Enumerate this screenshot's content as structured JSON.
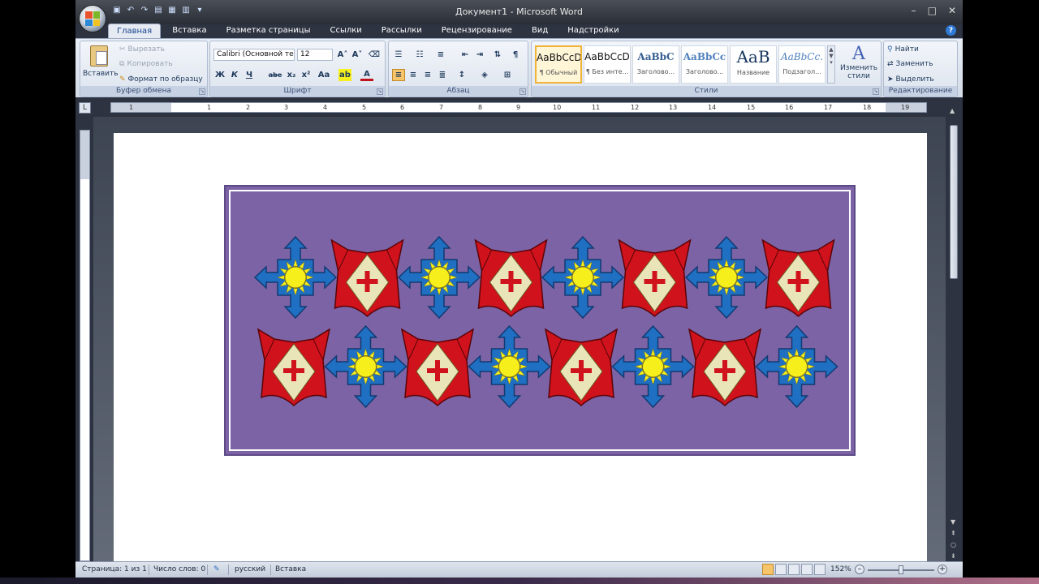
{
  "window": {
    "title": "Документ1 - Microsoft Word"
  },
  "window_controls": {
    "minimize": "–",
    "maximize": "□",
    "close": "✕"
  },
  "tabs": [
    {
      "label": "Главная"
    },
    {
      "label": "Вставка"
    },
    {
      "label": "Разметка страницы"
    },
    {
      "label": "Ссылки"
    },
    {
      "label": "Рассылки"
    },
    {
      "label": "Рецензирование"
    },
    {
      "label": "Вид"
    },
    {
      "label": "Надстройки"
    }
  ],
  "groups": {
    "clipboard": {
      "label": "Буфер обмена",
      "paste": "Вставить",
      "cut": "Вырезать",
      "copy": "Копировать",
      "format_painter": "Формат по образцу"
    },
    "font": {
      "label": "Шрифт",
      "font_name": "Calibri (Основной те",
      "font_size": "12"
    },
    "paragraph": {
      "label": "Абзац"
    },
    "styles": {
      "label": "Стили",
      "items": [
        {
          "preview": "AaBbCcD",
          "name": "¶ Обычный"
        },
        {
          "preview": "AaBbCcD",
          "name": "¶ Без инте..."
        },
        {
          "preview": "AaBbC",
          "name": "Заголово..."
        },
        {
          "preview": "AaBbCc",
          "name": "Заголово..."
        },
        {
          "preview": "AaB",
          "name": "Название"
        },
        {
          "preview": "AaBbCc.",
          "name": "Подзагол..."
        }
      ],
      "change_styles_line1": "Изменить",
      "change_styles_line2": "стили"
    },
    "editing": {
      "label": "Редактирование",
      "find": "Найти",
      "replace": "Заменить",
      "select": "Выделить"
    }
  },
  "font_buttons": {
    "bold": "Ж",
    "italic": "К",
    "underline": "Ч",
    "strike": "abe",
    "sub": "x₂",
    "sup": "x²",
    "case": "Aa",
    "color": "A"
  },
  "ruler_ticks": [
    "1",
    "1",
    "2",
    "3",
    "4",
    "5",
    "6",
    "7",
    "8",
    "9",
    "10",
    "11",
    "12",
    "13",
    "14",
    "15",
    "16",
    "17",
    "18",
    "19"
  ],
  "statusbar": {
    "page": "Страница: 1 из 1",
    "words": "Число слов: 0",
    "language": "русский",
    "mode": "Вставка",
    "zoom": "152%"
  },
  "colors": {
    "frame_bg": "#7c63a6",
    "shield_red": "#d0121c",
    "cross_cream": "#e9e5b8",
    "star_blue": "#1f6fc2",
    "sun_yellow": "#f7ef1b"
  },
  "ornament_rows": [
    [
      "star",
      "shield",
      "star",
      "shield",
      "star",
      "shield",
      "star",
      "shield"
    ],
    [
      "shield",
      "star",
      "shield",
      "star",
      "shield",
      "star",
      "shield",
      "star"
    ]
  ]
}
